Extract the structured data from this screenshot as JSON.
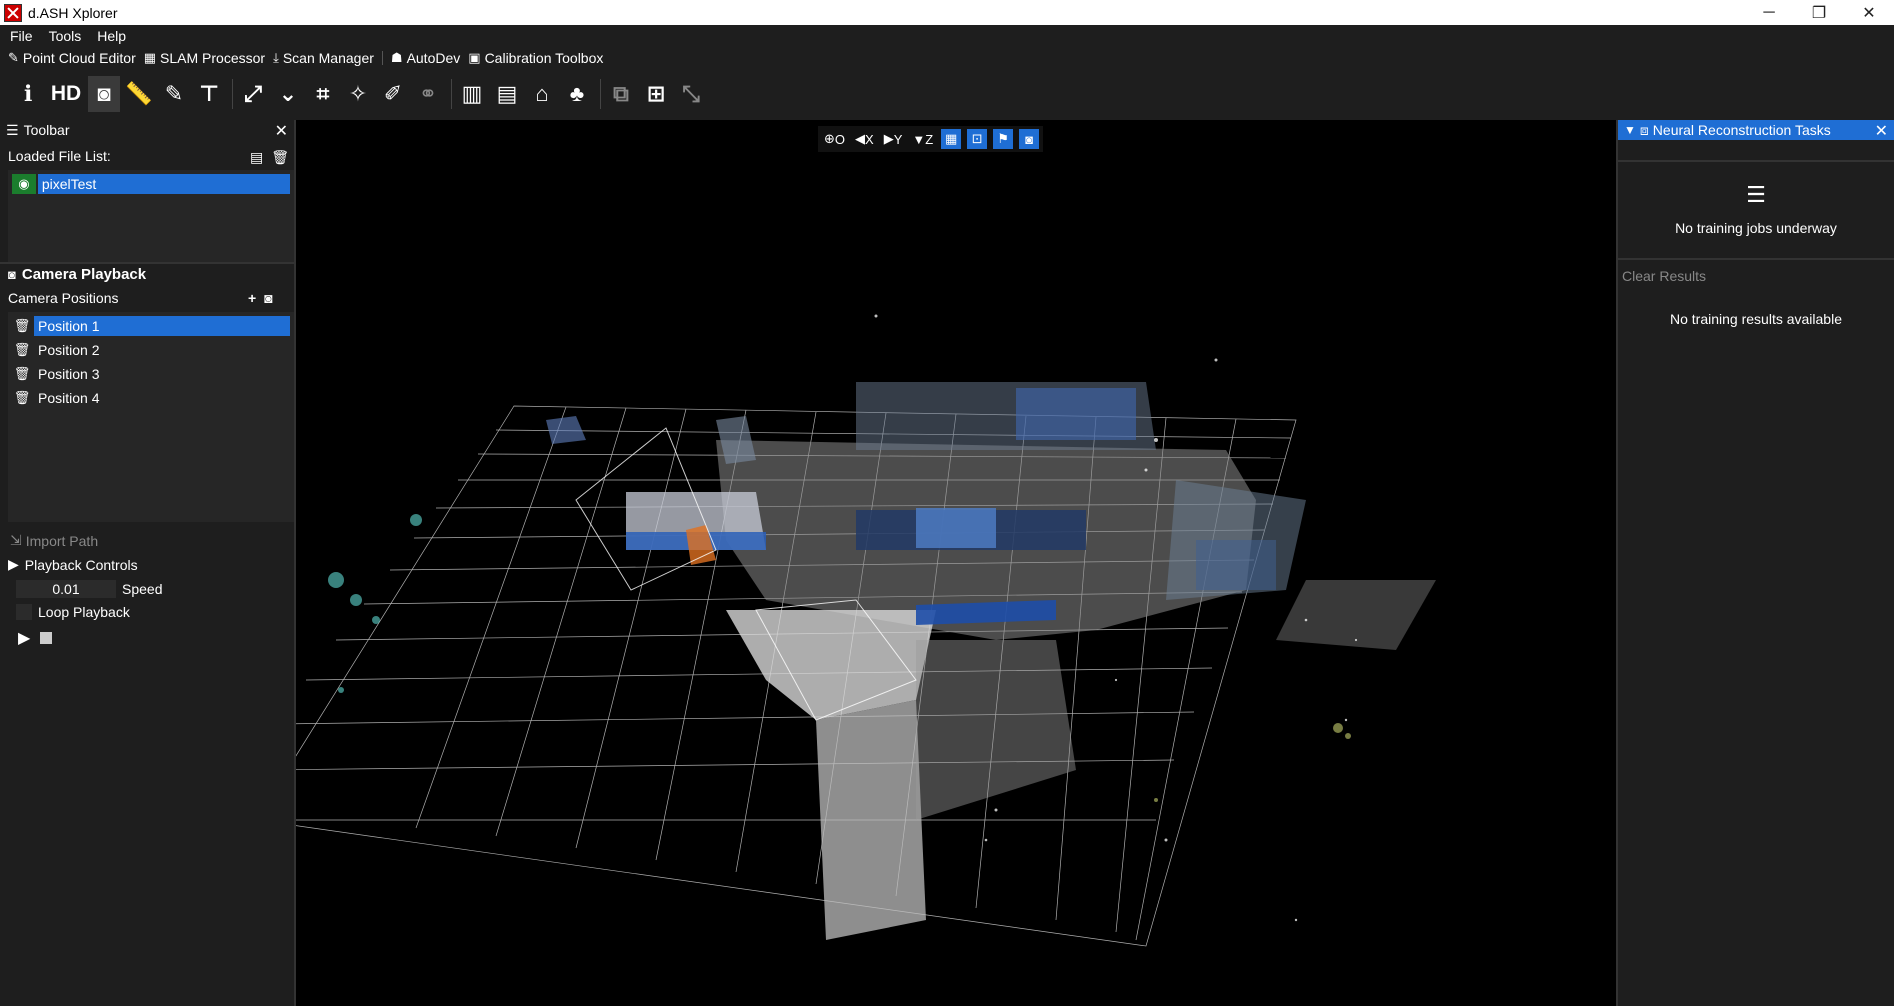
{
  "window": {
    "title": "d.ASH Xplorer",
    "controls": [
      "─",
      "❐",
      "✕"
    ]
  },
  "menu": {
    "items": [
      "File",
      "Tools",
      "Help"
    ]
  },
  "modules": [
    {
      "icon": "edit-icon",
      "glyph": "✎",
      "label": "Point Cloud Editor"
    },
    {
      "icon": "map-icon",
      "glyph": "▦",
      "label": "SLAM Processor"
    },
    {
      "icon": "download-icon",
      "glyph": "⤓",
      "label": "Scan Manager"
    },
    {
      "icon": "robot-icon",
      "glyph": "☗",
      "label": "AutoDev"
    },
    {
      "icon": "toolbox-icon",
      "glyph": "▣",
      "label": "Calibration Toolbox"
    }
  ],
  "toolbar": {
    "hd_label": "HD"
  },
  "left_panel": {
    "title": "Toolbar",
    "loaded_files_label": "Loaded File List:",
    "file": "pixelTest",
    "camera_playback_title": "Camera Playback",
    "camera_positions_label": "Camera Positions",
    "positions": [
      "Position 1",
      "Position 2",
      "Position 3",
      "Position 4"
    ],
    "import_path_label": "Import Path",
    "playback_controls_label": "Playback Controls",
    "speed_value": "0.01",
    "speed_label": "Speed",
    "loop_label": "Loop Playback"
  },
  "view_toolbar": {
    "o_label": "O",
    "x_label": "X",
    "y_label": "Y",
    "z_label": "Z"
  },
  "right_panel": {
    "title": "Neural Reconstruction Tasks",
    "no_jobs": "No training jobs underway",
    "clear_results": "Clear Results",
    "no_results": "No training results available"
  },
  "colors": {
    "accent": "#1f6ed4",
    "eye_green": "#1b7d2d",
    "panel_bg": "#1e1e1e",
    "annotation_arrow": "#ff0000"
  }
}
